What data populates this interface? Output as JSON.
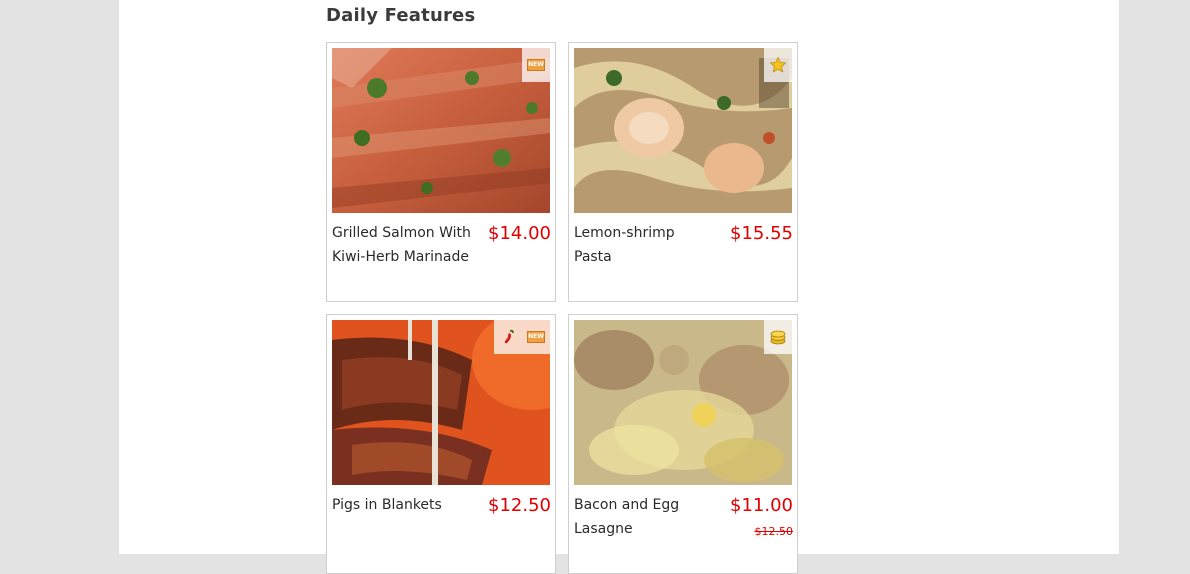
{
  "section": {
    "title": "Daily Features"
  },
  "items": [
    {
      "name": "Grilled Salmon With Kiwi-Herb Marinade",
      "price": "$14.00",
      "old_price": "",
      "badges": [
        "new-icon"
      ],
      "badge_text": "NEW"
    },
    {
      "name": "Lemon-shrimp Pasta",
      "price": "$15.55",
      "old_price": "",
      "badges": [
        "star-icon"
      ]
    },
    {
      "name": "Pigs in Blankets",
      "price": "$12.50",
      "old_price": "",
      "badges": [
        "chili-pepper-icon",
        "new-icon"
      ],
      "badge_text": "NEW"
    },
    {
      "name": "Bacon and Egg Lasagne",
      "price": "$11.00",
      "old_price": "$12.50",
      "badges": [
        "coins-icon"
      ]
    }
  ],
  "colors": {
    "price": "#e00000",
    "background": "#e3e3e3",
    "card_border": "#cfcfcf"
  }
}
